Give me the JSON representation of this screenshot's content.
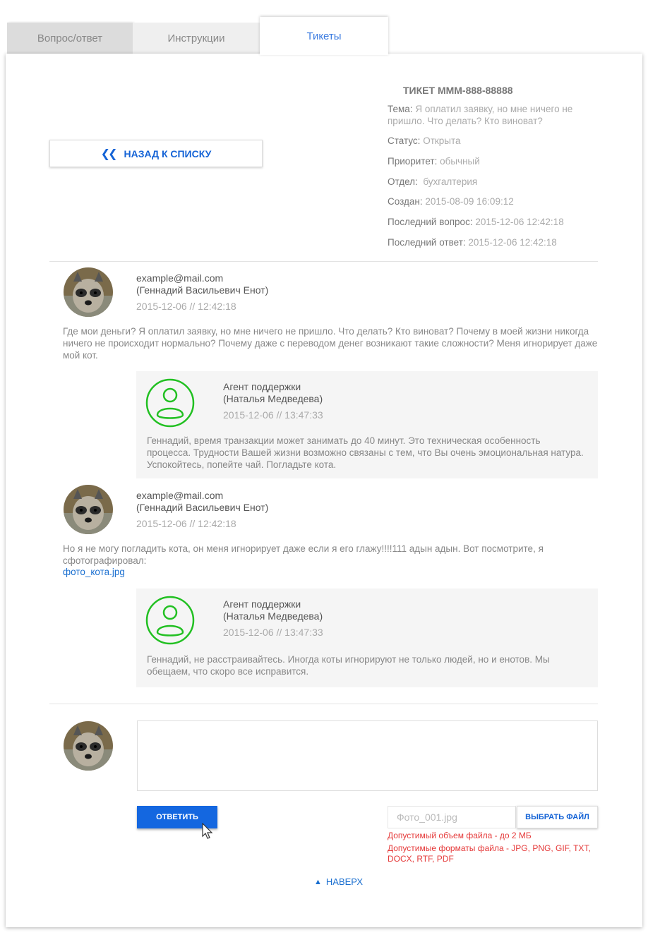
{
  "tabs": [
    {
      "label": "Вопрос/ответ"
    },
    {
      "label": "Инструкции"
    },
    {
      "label": "Тикеты"
    }
  ],
  "back_button": {
    "label": "НАЗАД К СПИСКУ",
    "icon": "double-chevron-left-icon"
  },
  "ticket": {
    "title": "ТИКЕТ МММ-888-88888",
    "topic_label": "Тема:",
    "topic_value": "Я оплатил заявку, но мне ничего не пришло. Что делать? Кто виноват?",
    "status_label": "Статус:",
    "status_value": "Открыта",
    "priority_label": "Приоритет:",
    "priority_value": "обычный",
    "dept_label": "Отдел:",
    "dept_value": "бухгалтерия",
    "created_label": "Создан:",
    "created_value": "2015-08-09 16:09:12",
    "last_question_label": "Последний вопрос:",
    "last_question_value": "2015-12-06 12:42:18",
    "last_answer_label": "Последний ответ:",
    "last_answer_value": "2015-12-06 12:42:18"
  },
  "messages": [
    {
      "email": "example@mail.com",
      "name": "(Геннадий Васильевич Енот)",
      "date": "2015-12-06  // 12:42:18",
      "text": "Где мои деньги? Я оплатил заявку, но мне ничего не пришло. Что делать? Кто виноват? Почему в моей жизни никогда ничего не происходит нормально? Почему даже с переводом денег возникают такие сложности? Меня игнорирует даже мой кот.",
      "reply": {
        "role": "Агент поддержки",
        "name": "(Наталья Медведева)",
        "date": "2015-12-06  // 13:47:33",
        "text": "Геннадий, время транзакции может занимать до 40 минут. Это техническая особенность процесса. Трудности Вашей жизни возможно связаны с тем, что Вы очень эмоциональная натура. Успокойтесь, попейте чай. Погладьте кота."
      }
    },
    {
      "email": "example@mail.com",
      "name": "(Геннадий Васильевич Енот)",
      "date": "2015-12-06  // 12:42:18",
      "text": "Но я не могу погладить кота, он меня игнорирует даже если я его глажу!!!!111 адын адын. Вот посмотрите, я сфотографировал:",
      "attachment": "фото_кота.jpg",
      "reply": {
        "role": "Агент поддержки",
        "name": "(Наталья Медведева)",
        "date": "2015-12-06  // 13:47:33",
        "text": "Геннадий, не расстраивайтесь. Иногда коты игнорируют не только людей, но и енотов. Мы обещаем, что скоро все исправится."
      }
    }
  ],
  "form": {
    "textarea_value": "",
    "answer_label": "ОТВЕТИТЬ",
    "file_placeholder": "Фото_001.jpg",
    "choose_file_label": "ВЫБРАТЬ ФАЙЛ",
    "size_note": "Допустимый объем файла - до 2 МБ",
    "formats_note": "Допустимые форматы файла - JPG, PNG, GIF, TXT, DOCX, RTF, PDF"
  },
  "to_top": {
    "label": "НАВЕРХ",
    "icon": "caret-up-icon"
  },
  "colors": {
    "accent": "#1467e0",
    "agent_icon": "#22c022",
    "error": "#e53a3a"
  }
}
